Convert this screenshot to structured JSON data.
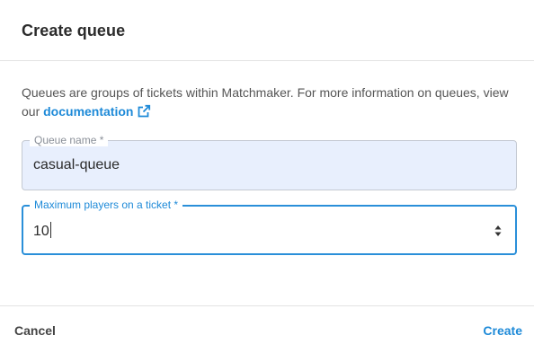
{
  "dialog": {
    "title": "Create queue",
    "description_prefix": "Queues are groups of tickets within Matchmaker. For more information on queues, view our",
    "documentation_link": "documentation"
  },
  "fields": {
    "queue_name": {
      "label": "Queue name *",
      "value": "casual-queue"
    },
    "max_players": {
      "label": "Maximum players on a ticket *",
      "value": "10"
    }
  },
  "footer": {
    "cancel_label": "Cancel",
    "create_label": "Create"
  },
  "colors": {
    "accent": "#1e8ad8",
    "filled_field_bg": "#e8effd",
    "text": "#2b2b2b"
  },
  "icons": {
    "documentation_link_icon": "external-link-icon",
    "stepper": "number-stepper-arrows"
  }
}
